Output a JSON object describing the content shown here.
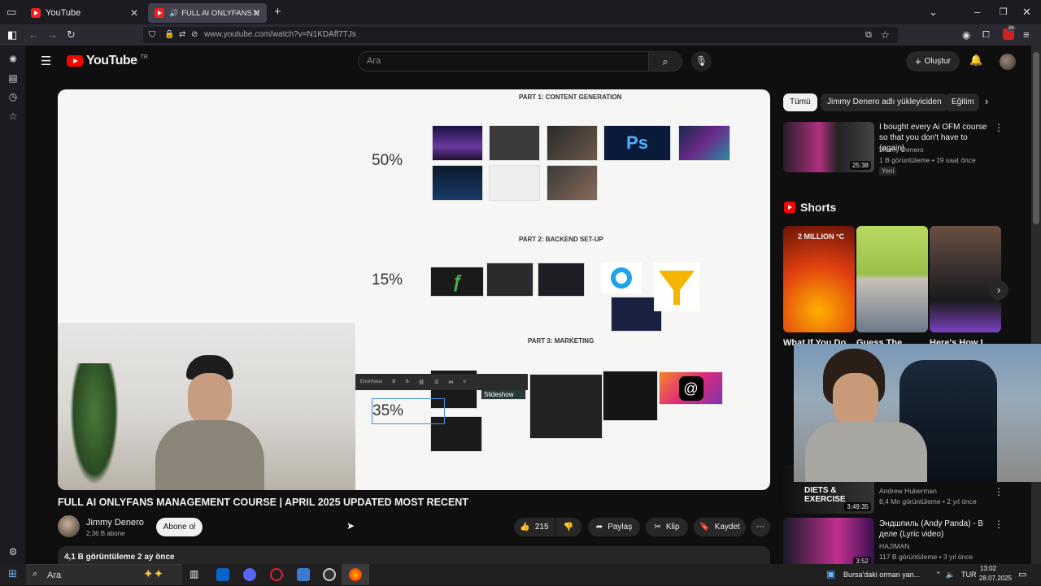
{
  "browser": {
    "tabs": [
      {
        "title": "YouTube"
      },
      {
        "title": "FULL AI ONLYFANS MANAG"
      }
    ],
    "url": "www.youtube.com/watch?v=N1KDAff7TJs"
  },
  "yt": {
    "logo_text": "YouTube",
    "region": "TR",
    "search_placeholder": "Ara",
    "create_label": "Oluştur"
  },
  "video_content": {
    "part1": "PART 1: CONTENT GENERATION",
    "part2": "PART 2: BACKEND SET-UP",
    "part3": "PART 3: MARKETING",
    "pct1": "50%",
    "pct2": "15%",
    "pct3": "35%",
    "toolbar_font": "Enormous",
    "slideshow_label": "Slideshow"
  },
  "meta": {
    "title": "FULL AI ONLYFANS MANAGEMENT COURSE | APRIL 2025 UPDATED MOST RECENT",
    "channel": "Jimmy Denero",
    "subs": "2,36 B abone",
    "subscribe": "Abone ol",
    "likes": "215",
    "share": "Paylaş",
    "clip": "Klip",
    "save": "Kaydet",
    "views_date": "4,1 B görüntüleme  2 ay önce"
  },
  "chips": [
    "Tümü",
    "Jimmy Denero adlı yükleyiciden",
    "Eğitim"
  ],
  "recommended": [
    {
      "title": "I bought every Ai OFM course so that you don't have to (again)",
      "channel": "Jimmy Denero",
      "stats": "1 B görüntüleme • 19 saat önce",
      "badge": "Yeni",
      "duration": "25:38"
    },
    {
      "title": "",
      "channel": "Andrew Huberman",
      "stats": "8,4 Mn görüntüleme • 2 yıl önce",
      "duration": "3:49:35",
      "thumb_text": "DIETS & EXERCISE"
    },
    {
      "title": "Эндшпиль (Andy Panda) - В деле (Lyric video)",
      "channel": "HAJIMAN",
      "stats": "117 B görüntüleme • 3 yıl önce",
      "duration": "3:52"
    }
  ],
  "shorts": {
    "heading": "Shorts",
    "items": [
      {
        "title": "What If You Do...",
        "thumb_text": "2 MILLION °C"
      },
      {
        "title": "Guess The...",
        "thumb_text": ""
      },
      {
        "title": "Here's How I...",
        "thumb_text": ""
      }
    ]
  },
  "taskbar": {
    "search": "Ara",
    "weather": "Bursa'daki orman yan...",
    "lang": "TUR",
    "time": "13:02",
    "date": "28.07.2025",
    "notif_count": "24"
  }
}
